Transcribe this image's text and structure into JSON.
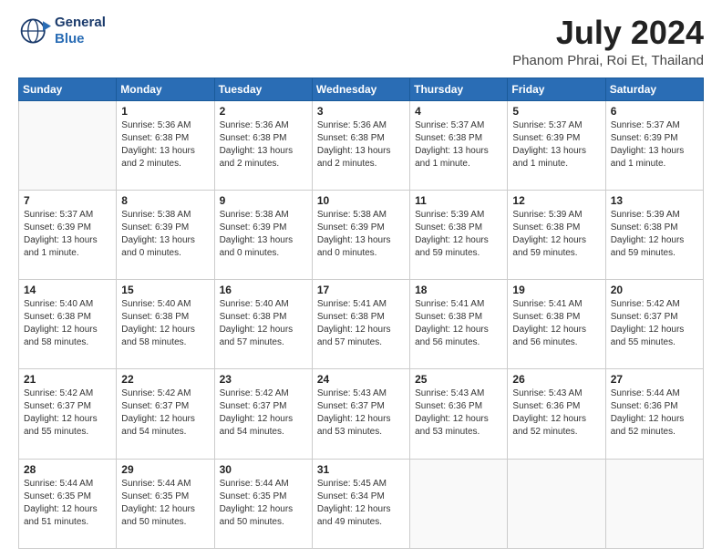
{
  "header": {
    "logo_line1": "General",
    "logo_line2": "Blue",
    "title": "July 2024",
    "subtitle": "Phanom Phrai, Roi Et, Thailand"
  },
  "days_of_week": [
    "Sunday",
    "Monday",
    "Tuesday",
    "Wednesday",
    "Thursday",
    "Friday",
    "Saturday"
  ],
  "weeks": [
    [
      {
        "day": "",
        "info": ""
      },
      {
        "day": "1",
        "info": "Sunrise: 5:36 AM\nSunset: 6:38 PM\nDaylight: 13 hours\nand 2 minutes."
      },
      {
        "day": "2",
        "info": "Sunrise: 5:36 AM\nSunset: 6:38 PM\nDaylight: 13 hours\nand 2 minutes."
      },
      {
        "day": "3",
        "info": "Sunrise: 5:36 AM\nSunset: 6:38 PM\nDaylight: 13 hours\nand 2 minutes."
      },
      {
        "day": "4",
        "info": "Sunrise: 5:37 AM\nSunset: 6:38 PM\nDaylight: 13 hours\nand 1 minute."
      },
      {
        "day": "5",
        "info": "Sunrise: 5:37 AM\nSunset: 6:39 PM\nDaylight: 13 hours\nand 1 minute."
      },
      {
        "day": "6",
        "info": "Sunrise: 5:37 AM\nSunset: 6:39 PM\nDaylight: 13 hours\nand 1 minute."
      }
    ],
    [
      {
        "day": "7",
        "info": "Sunrise: 5:37 AM\nSunset: 6:39 PM\nDaylight: 13 hours\nand 1 minute."
      },
      {
        "day": "8",
        "info": "Sunrise: 5:38 AM\nSunset: 6:39 PM\nDaylight: 13 hours\nand 0 minutes."
      },
      {
        "day": "9",
        "info": "Sunrise: 5:38 AM\nSunset: 6:39 PM\nDaylight: 13 hours\nand 0 minutes."
      },
      {
        "day": "10",
        "info": "Sunrise: 5:38 AM\nSunset: 6:39 PM\nDaylight: 13 hours\nand 0 minutes."
      },
      {
        "day": "11",
        "info": "Sunrise: 5:39 AM\nSunset: 6:38 PM\nDaylight: 12 hours\nand 59 minutes."
      },
      {
        "day": "12",
        "info": "Sunrise: 5:39 AM\nSunset: 6:38 PM\nDaylight: 12 hours\nand 59 minutes."
      },
      {
        "day": "13",
        "info": "Sunrise: 5:39 AM\nSunset: 6:38 PM\nDaylight: 12 hours\nand 59 minutes."
      }
    ],
    [
      {
        "day": "14",
        "info": "Sunrise: 5:40 AM\nSunset: 6:38 PM\nDaylight: 12 hours\nand 58 minutes."
      },
      {
        "day": "15",
        "info": "Sunrise: 5:40 AM\nSunset: 6:38 PM\nDaylight: 12 hours\nand 58 minutes."
      },
      {
        "day": "16",
        "info": "Sunrise: 5:40 AM\nSunset: 6:38 PM\nDaylight: 12 hours\nand 57 minutes."
      },
      {
        "day": "17",
        "info": "Sunrise: 5:41 AM\nSunset: 6:38 PM\nDaylight: 12 hours\nand 57 minutes."
      },
      {
        "day": "18",
        "info": "Sunrise: 5:41 AM\nSunset: 6:38 PM\nDaylight: 12 hours\nand 56 minutes."
      },
      {
        "day": "19",
        "info": "Sunrise: 5:41 AM\nSunset: 6:38 PM\nDaylight: 12 hours\nand 56 minutes."
      },
      {
        "day": "20",
        "info": "Sunrise: 5:42 AM\nSunset: 6:37 PM\nDaylight: 12 hours\nand 55 minutes."
      }
    ],
    [
      {
        "day": "21",
        "info": "Sunrise: 5:42 AM\nSunset: 6:37 PM\nDaylight: 12 hours\nand 55 minutes."
      },
      {
        "day": "22",
        "info": "Sunrise: 5:42 AM\nSunset: 6:37 PM\nDaylight: 12 hours\nand 54 minutes."
      },
      {
        "day": "23",
        "info": "Sunrise: 5:42 AM\nSunset: 6:37 PM\nDaylight: 12 hours\nand 54 minutes."
      },
      {
        "day": "24",
        "info": "Sunrise: 5:43 AM\nSunset: 6:37 PM\nDaylight: 12 hours\nand 53 minutes."
      },
      {
        "day": "25",
        "info": "Sunrise: 5:43 AM\nSunset: 6:36 PM\nDaylight: 12 hours\nand 53 minutes."
      },
      {
        "day": "26",
        "info": "Sunrise: 5:43 AM\nSunset: 6:36 PM\nDaylight: 12 hours\nand 52 minutes."
      },
      {
        "day": "27",
        "info": "Sunrise: 5:44 AM\nSunset: 6:36 PM\nDaylight: 12 hours\nand 52 minutes."
      }
    ],
    [
      {
        "day": "28",
        "info": "Sunrise: 5:44 AM\nSunset: 6:35 PM\nDaylight: 12 hours\nand 51 minutes."
      },
      {
        "day": "29",
        "info": "Sunrise: 5:44 AM\nSunset: 6:35 PM\nDaylight: 12 hours\nand 50 minutes."
      },
      {
        "day": "30",
        "info": "Sunrise: 5:44 AM\nSunset: 6:35 PM\nDaylight: 12 hours\nand 50 minutes."
      },
      {
        "day": "31",
        "info": "Sunrise: 5:45 AM\nSunset: 6:34 PM\nDaylight: 12 hours\nand 49 minutes."
      },
      {
        "day": "",
        "info": ""
      },
      {
        "day": "",
        "info": ""
      },
      {
        "day": "",
        "info": ""
      }
    ]
  ]
}
